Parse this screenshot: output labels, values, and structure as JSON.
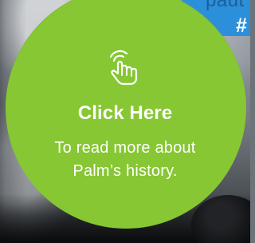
{
  "background_card": {
    "partial_text": "paut",
    "hash_text": "#"
  },
  "promo": {
    "icon": "tap-icon",
    "title": "Click Here",
    "subtitle_line_1": "To read more about",
    "subtitle_line_2": "Palm’s history."
  },
  "colors": {
    "promo_green": "#86c733",
    "text_white": "#ffffff",
    "blue_card": "#2c8fda",
    "blue_text": "#1d5f97"
  }
}
